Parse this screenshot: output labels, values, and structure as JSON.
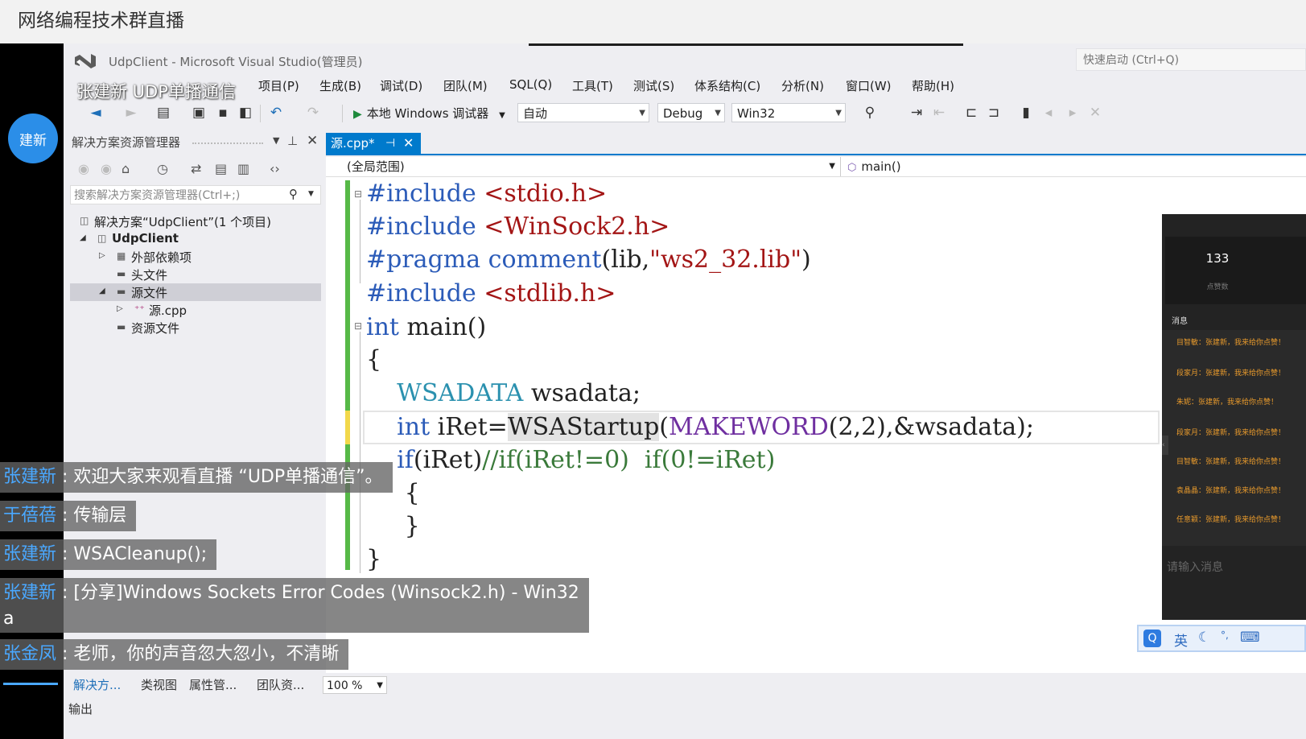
{
  "stream": {
    "title": "网络编程技术群直播",
    "avatar_text": "建新",
    "session_title": "张建新 UDP单播通信"
  },
  "window": {
    "title": "UdpClient - Microsoft Visual Studio(管理员)",
    "quick_launch": "快速启动 (Ctrl+Q)"
  },
  "menu": [
    {
      "label": "项目(P)"
    },
    {
      "label": "生成(B)"
    },
    {
      "label": "调试(D)"
    },
    {
      "label": "团队(M)"
    },
    {
      "label": "SQL(Q)"
    },
    {
      "label": "工具(T)"
    },
    {
      "label": "测试(S)"
    },
    {
      "label": "体系结构(C)"
    },
    {
      "label": "分析(N)"
    },
    {
      "label": "窗口(W)"
    },
    {
      "label": "帮助(H)"
    }
  ],
  "toolbar": {
    "run_label": "本地 Windows 调试器",
    "mode": "自动",
    "config": "Debug",
    "platform": "Win32"
  },
  "solution_explorer": {
    "title": "解决方案资源管理器",
    "search_placeholder": "搜索解决方案资源管理器(Ctrl+;)",
    "tree": [
      {
        "label": "解决方案“UdpClient”(1 个项目)"
      },
      {
        "label": "UdpClient"
      },
      {
        "label": "外部依赖项"
      },
      {
        "label": "头文件"
      },
      {
        "label": "源文件"
      },
      {
        "label": "源.cpp"
      },
      {
        "label": "资源文件"
      }
    ]
  },
  "editor": {
    "tab_label": "源.cpp*",
    "scope": "(全局范围)",
    "function": "main()",
    "lines": [
      [
        {
          "t": "#include ",
          "c": "pp"
        },
        {
          "t": "<stdio.h>",
          "c": "str"
        }
      ],
      [
        {
          "t": "#include ",
          "c": "pp"
        },
        {
          "t": "<WinSock2.h>",
          "c": "str"
        }
      ],
      [
        {
          "t": "#pragma comment",
          "c": "pp"
        },
        {
          "t": "(lib,",
          "c": ""
        },
        {
          "t": "\"ws2_32.lib\"",
          "c": "str"
        },
        {
          "t": ")",
          "c": ""
        }
      ],
      [
        {
          "t": "#include ",
          "c": "pp"
        },
        {
          "t": "<stdlib.h>",
          "c": "str"
        }
      ],
      [
        {
          "t": "int",
          "c": "kw"
        },
        {
          "t": " main()",
          "c": ""
        }
      ],
      [
        {
          "t": "{",
          "c": ""
        }
      ],
      [
        {
          "t": "    ",
          "c": ""
        },
        {
          "t": "WSADATA",
          "c": "type"
        },
        {
          "t": " wsadata;",
          "c": ""
        }
      ],
      [
        {
          "t": "    ",
          "c": ""
        },
        {
          "t": "int",
          "c": "kw"
        },
        {
          "t": " iRet=",
          "c": ""
        },
        {
          "t": "WSAStartup",
          "c": "hl"
        },
        {
          "t": "(",
          "c": ""
        },
        {
          "t": "MAKEWORD",
          "c": "fn"
        },
        {
          "t": "(2,2),&wsadata);",
          "c": ""
        }
      ],
      [
        {
          "t": "    ",
          "c": ""
        },
        {
          "t": "if",
          "c": "kw"
        },
        {
          "t": "(iRet)",
          "c": ""
        },
        {
          "t": "//if(iRet!=0)  if(0!=iRet)",
          "c": "cm"
        }
      ],
      [
        {
          "t": "     {",
          "c": ""
        }
      ],
      [
        {
          "t": "     }",
          "c": ""
        }
      ],
      [
        {
          "t": "}",
          "c": ""
        }
      ]
    ]
  },
  "side_panel": {
    "count": "133",
    "count_label": "点赞数",
    "messages_title": "消息",
    "messages": [
      "目智敏：张建新，我来给你点赞！",
      "段家月：张建新，我来给你点赞！",
      "朱妮：张建新，我来给你点赞！",
      "段家月：张建新，我来给你点赞！",
      "目智敏：张建新，我来给你点赞！",
      "袁晶晶：张建新，我来给你点赞！",
      "任意颖：张建新，我来给你点赞！"
    ],
    "input_placeholder": "请输入消息"
  },
  "ime": {
    "lang": "英"
  },
  "bottom_tabs": [
    {
      "label": "解决方..."
    },
    {
      "label": "类视图"
    },
    {
      "label": "属性管..."
    },
    {
      "label": "团队资..."
    }
  ],
  "zoom": "100 %",
  "output_label": "输出",
  "chat": [
    {
      "user": "张建新",
      "message": "欢迎大家来观看直播 “UDP单播通信”。"
    },
    {
      "user": "于蓓蓓",
      "message": "传输层"
    },
    {
      "user": "张建新",
      "message": "WSACleanup();"
    },
    {
      "user": "张建新",
      "message": "[分享]Windows Sockets Error Codes (Winsock2.h) - Win32",
      "continuation": "a"
    },
    {
      "user": "张金凤",
      "message": "老师，你的声音忽大忽小，不清晰"
    }
  ],
  "colors": {
    "accent": "#007acc",
    "avatar": "#2b8ee8",
    "chat_user": "#4aa8ff",
    "gutter_changed": "#56b947",
    "gutter_unsaved": "#f2d84a"
  }
}
